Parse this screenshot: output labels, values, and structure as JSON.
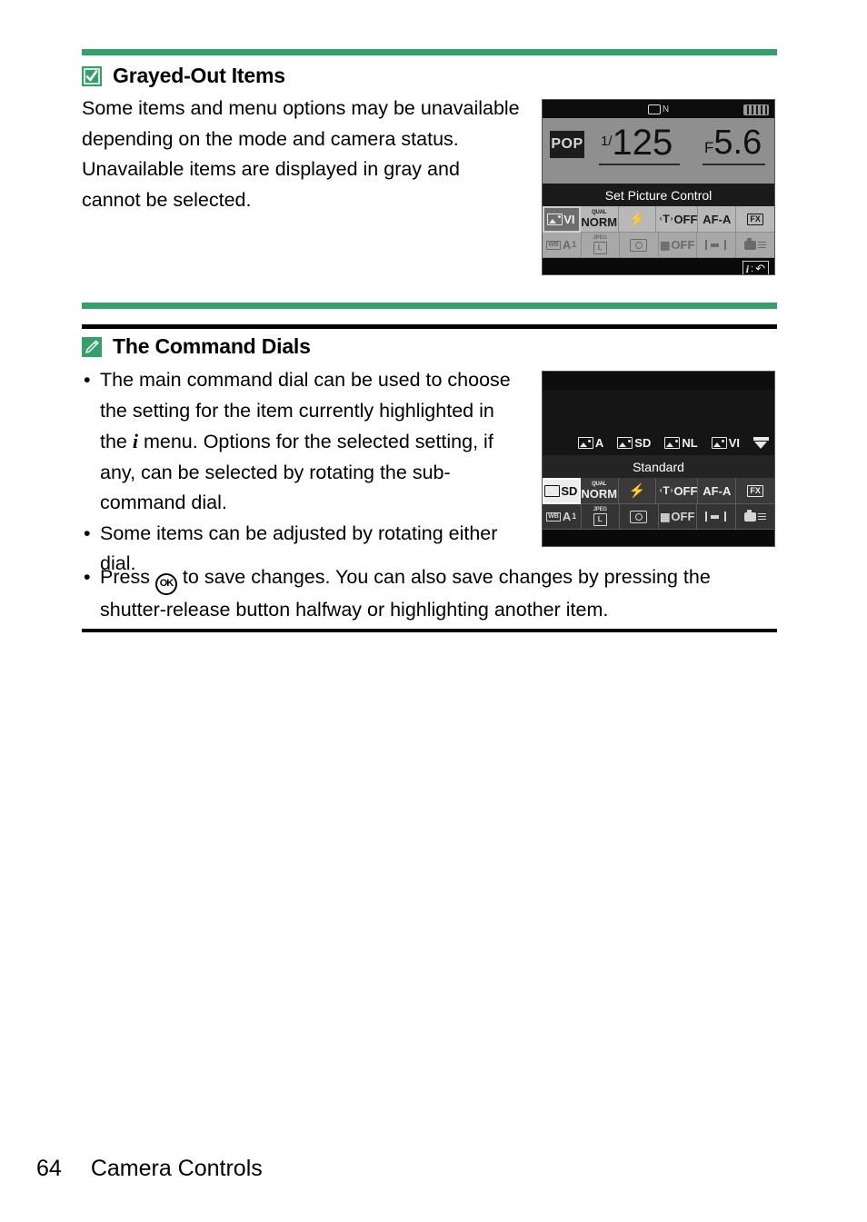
{
  "page": {
    "number": "64",
    "footer_title": "Camera Controls"
  },
  "sections": [
    {
      "id": "grayed-out-items",
      "badge_icon": "checkmark-icon",
      "badge_color": "#35a06a",
      "heading": "Grayed-Out Items",
      "body": "Some items and menu options may be unavailable depending on the mode and camera status. Unavailable items are displayed in gray and cannot be selected."
    },
    {
      "id": "the-command-dials",
      "badge_icon": "pencil-icon",
      "badge_color": "#35a06a",
      "heading": "The Command Dials",
      "bullets": [
        {
          "part1": "The main command dial can be used to choose the setting for the item currently highlighted in the ",
          "glyph": "i",
          "part2": " menu. Options for the selected setting, if any, can be selected by rotating the sub-command dial."
        },
        {
          "part1": "Some items can be adjusted by rotating either dial.",
          "glyph": "",
          "part2": ""
        },
        {
          "part1": "Press ",
          "glyph": "OK",
          "part2": " to save changes. You can also save changes by pressing the shutter-release button halfway or highlighting another item."
        }
      ]
    }
  ],
  "lcd1": {
    "top": {
      "frame_icon": "frame-rect-icon",
      "frame_label": "N",
      "battery_icon": "battery-icon"
    },
    "exposure": {
      "mode": "POP",
      "shutter_prefix": "1/",
      "shutter_value": "125",
      "aperture_prefix": "F",
      "aperture_value": "5.6"
    },
    "title": "Set Picture Control",
    "grid_row1": [
      {
        "name": "picture-control",
        "icon": "picture-control-icon",
        "label": "VI",
        "selected": true,
        "dim": false
      },
      {
        "name": "image-quality",
        "tiny": "QUAL",
        "label": "NORM",
        "selected": false,
        "dim": false
      },
      {
        "name": "flash-mode",
        "icon": "flash-icon",
        "label": "",
        "selected": false,
        "dim": false
      },
      {
        "name": "flash-compensation",
        "icon": "flash-comp-icon",
        "label": "OFF",
        "selected": false,
        "dim": false
      },
      {
        "name": "focus-mode",
        "label": "AF-A",
        "selected": false,
        "dim": false
      },
      {
        "name": "image-area",
        "label": "FX",
        "boxed": true,
        "selected": false,
        "dim": false
      }
    ],
    "grid_row2": [
      {
        "name": "white-balance",
        "wb": "WB",
        "label": "A",
        "sub": "1",
        "selected": false,
        "dim": true
      },
      {
        "name": "image-size",
        "tiny": "JPEG",
        "icon": "image-size-icon",
        "label": "L",
        "selected": false,
        "dim": false
      },
      {
        "name": "metering",
        "icon": "metering-icon",
        "label": "",
        "selected": false,
        "dim": true
      },
      {
        "name": "bracketing",
        "icon": "bracketing-icon",
        "label": "OFF",
        "selected": false,
        "dim": true
      },
      {
        "name": "af-area-mode",
        "icon": "af-area-icon",
        "label": "",
        "selected": false,
        "dim": false
      },
      {
        "name": "custom-settings",
        "icon": "camera-menu-icon",
        "label": "",
        "selected": false,
        "dim": false
      }
    ],
    "bottom": {
      "i_label": "i",
      "separator": ":",
      "back_icon": "return-arrow-icon"
    }
  },
  "lcd2": {
    "picture_controls": [
      {
        "label": "A"
      },
      {
        "label": "SD"
      },
      {
        "label": "NL"
      },
      {
        "label": "VI"
      }
    ],
    "scroll_icon": "scroll-down-cursor-icon",
    "title": "Standard",
    "grid_row1": [
      {
        "name": "picture-control",
        "icon": "picture-control-icon",
        "label": "SD",
        "selected": true,
        "dim": false
      },
      {
        "name": "image-quality",
        "tiny": "QUAL",
        "label": "NORM",
        "selected": false,
        "dim": false
      },
      {
        "name": "flash-mode",
        "icon": "flash-icon",
        "label": "",
        "selected": false,
        "dim": false
      },
      {
        "name": "flash-compensation",
        "icon": "flash-comp-icon",
        "label": "OFF",
        "selected": false,
        "dim": false
      },
      {
        "name": "focus-mode",
        "label": "AF-A",
        "selected": false,
        "dim": false
      },
      {
        "name": "image-area",
        "label": "FX",
        "boxed": true,
        "selected": false,
        "dim": false
      }
    ],
    "grid_row2": [
      {
        "name": "white-balance",
        "wb": "WB",
        "label": "A",
        "sub": "1",
        "selected": false,
        "dim": false
      },
      {
        "name": "image-size",
        "tiny": "JPEG",
        "icon": "image-size-icon",
        "label": "L",
        "selected": false,
        "dim": false
      },
      {
        "name": "metering",
        "icon": "metering-icon",
        "label": "",
        "selected": false,
        "dim": false
      },
      {
        "name": "bracketing",
        "icon": "bracketing-icon",
        "label": "OFF",
        "selected": false,
        "dim": false
      },
      {
        "name": "af-area-mode",
        "icon": "af-area-icon",
        "label": "",
        "selected": false,
        "dim": false
      },
      {
        "name": "custom-settings",
        "icon": "camera-menu-icon",
        "label": "",
        "selected": false,
        "dim": false
      }
    ]
  }
}
